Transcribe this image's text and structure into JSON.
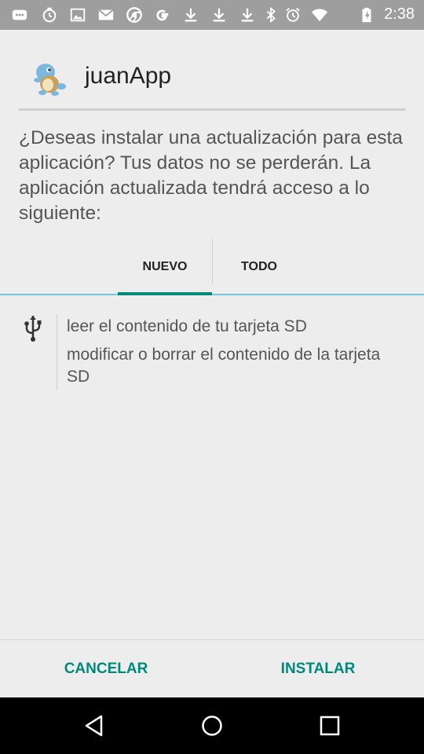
{
  "status_bar": {
    "time": "2:38",
    "icons": [
      "messages-icon",
      "alarm-icon",
      "image-icon",
      "gmail-icon",
      "chrome-icon",
      "google-icon",
      "download-icon",
      "download-icon",
      "download-icon",
      "bluetooth-icon",
      "alarm-clock-icon",
      "wifi-icon",
      "battery-icon"
    ]
  },
  "app": {
    "name": "juanApp",
    "icon": "squirtle-app-icon"
  },
  "prompt": "¿Deseas instalar una actualización para esta aplicación? Tus datos no se perderán. La aplicación actualizada tendrá acceso a lo siguiente:",
  "tabs": [
    {
      "label": "NUEVO",
      "selected": true
    },
    {
      "label": "TODO",
      "selected": false
    }
  ],
  "permissions": {
    "group_icon": "usb-storage-icon",
    "items": [
      "leer el contenido de tu tarjeta SD",
      "modificar o borrar el contenido de la tarjeta SD"
    ]
  },
  "buttons": {
    "cancel": "CANCELAR",
    "install": "INSTALAR"
  },
  "colors": {
    "accent": "#00897b",
    "status_bar": "#9e9e9e",
    "background": "#ededed",
    "tab_line": "#6fc7d9"
  },
  "nav": [
    "back-icon",
    "home-icon",
    "recents-icon"
  ]
}
